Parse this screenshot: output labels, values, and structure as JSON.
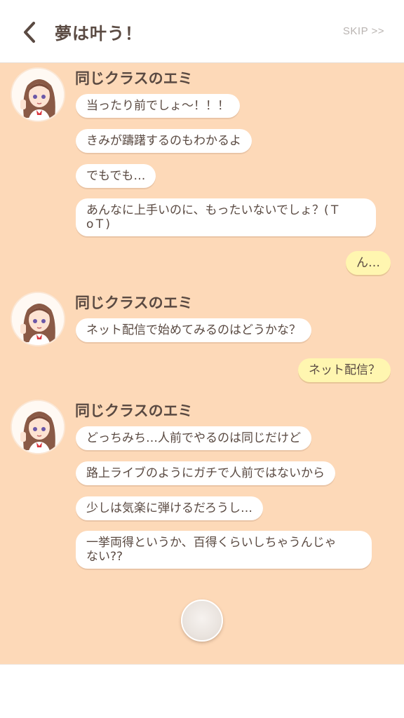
{
  "header": {
    "title": "夢は叶う！",
    "skip_label": "SKIP >>"
  },
  "colors": {
    "chat_background": "#fdd9b8",
    "incoming_bubble": "#ffffff",
    "outgoing_bubble": "#fff6b0",
    "text": "#5a4a42"
  },
  "messages": {
    "group1": {
      "sender": "同じクラスのエミ",
      "lines": [
        "当ったり前でしょ～！！！",
        "きみが躊躇するのもわかるよ",
        "でもでも…",
        "あんなに上手いのに、もったいないでしょ？(Ｔ\noＴ)"
      ]
    },
    "reply1": "ん…",
    "group2": {
      "sender": "同じクラスのエミ",
      "lines": [
        "ネット配信で始めてみるのはどうかな？"
      ]
    },
    "reply2": "ネット配信？",
    "group3": {
      "sender": "同じクラスのエミ",
      "lines": [
        "どっちみち…人前でやるのは同じだけど",
        "路上ライブのようにガチで人前ではないから",
        "少しは気楽に弾けるだろうし…",
        "一挙両得というか、百得くらいしちゃうんじゃ\nない??"
      ]
    }
  }
}
